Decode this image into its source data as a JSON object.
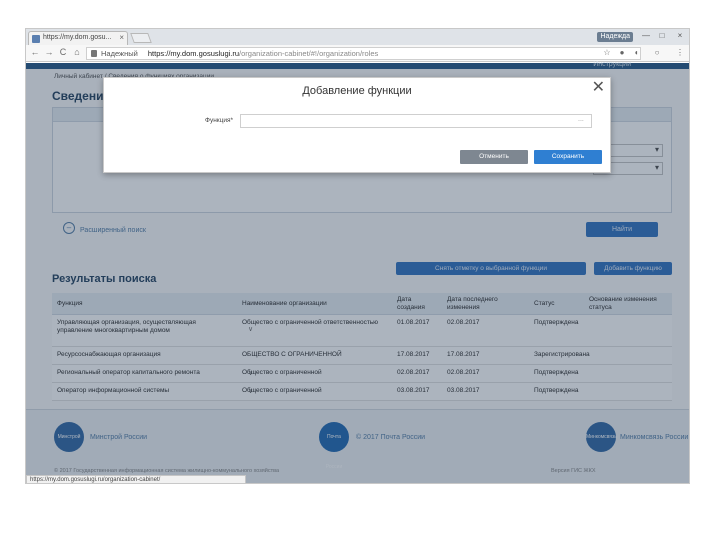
{
  "browser": {
    "tab_title": "https://my.dom.gosu...",
    "tab_close": "×",
    "user_badge": "Надежда",
    "win_min": "—",
    "win_max": "□",
    "win_close": "×",
    "nav_back": "←",
    "nav_forward": "→",
    "nav_reload": "C",
    "nav_home": "⌂",
    "security_label": "Надежный",
    "url_host": "https://my.dom.gosuslugi.ru",
    "url_path": "/organization-cabinet/#!/organization/roles",
    "bookmark_star": "☆",
    "menu_dots": "⋮",
    "status_url": "https://my.dom.gosuslugi.ru/organization-cabinet/"
  },
  "page": {
    "instructions_link": "Инструкции",
    "breadcrumb": "Личный кабинет / Сведения о функциях организации",
    "section_title": "Сведения",
    "advanced_search": "Расширенный поиск",
    "find_button": "Найти",
    "results_title": "Результаты поиска",
    "add_button": "Добавить функцию",
    "action_button": "Снять отметку о выбранной функции"
  },
  "table": {
    "headers": {
      "function": "Функция",
      "org_name": "Наименование организации",
      "date_created": "Дата создания",
      "date_modified": "Дата последнего изменения",
      "status": "Статус",
      "basis": "Основание изменения статуса"
    },
    "rows": [
      {
        "function": "Управляющая организация, осуществляющая управление многоквартирным домом",
        "org": "Общество с ограниченной ответственностью",
        "created": "01.08.2017",
        "modified": "02.08.2017",
        "status": "Подтверждена"
      },
      {
        "function": "Ресурсоснабжающая организация",
        "org": "ОБЩЕСТВО С ОГРАНИЧЕННОЙ",
        "created": "17.08.2017",
        "modified": "17.08.2017",
        "status": "Зарегистрирована"
      },
      {
        "function": "Региональный оператор капитального ремонта",
        "org": "Общество с ограниченной",
        "created": "02.08.2017",
        "modified": "02.08.2017",
        "status": "Подтверждена"
      },
      {
        "function": "Оператор информационной системы",
        "org": "Общество с ограниченной",
        "created": "03.08.2017",
        "modified": "03.08.2017",
        "status": "Подтверждена"
      }
    ]
  },
  "footer": {
    "logo_left_text": "Минстрой",
    "link_left": "Минстрой России",
    "logo_center_text": "Почта России",
    "link_center": "© 2017 Почта России",
    "logo_right_text": "Минкомсвязь",
    "link_right": "Минкомсвязь России",
    "copyright_left": "© 2017 Государственная информационная система жилищно-коммунального хозяйства",
    "copyright_right": "Версия ГИС ЖКХ"
  },
  "modal": {
    "title": "Добавление функции",
    "close_glyph": "✕",
    "function_label": "Функция*",
    "function_value": "",
    "function_placeholder": "",
    "picker_dots": "...",
    "cancel_label": "Отменить",
    "save_label": "Сохранить"
  },
  "colors": {
    "primary_button": "#2f7fd2",
    "cancel_button": "#7e8791",
    "overlay": "#12284a"
  }
}
